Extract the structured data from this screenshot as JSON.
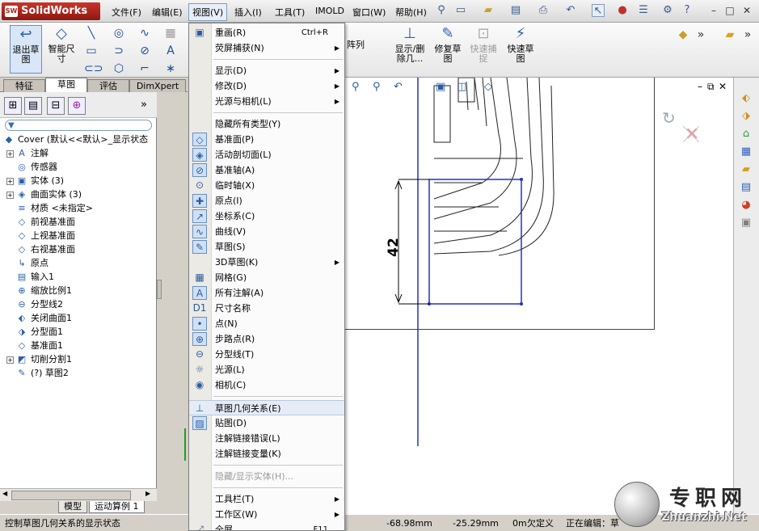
{
  "app": {
    "logo": "SolidWorks",
    "logo_badge": "SW"
  },
  "menubar": [
    {
      "id": "file",
      "label": "文件(F)"
    },
    {
      "id": "edit",
      "label": "编辑(E)"
    },
    {
      "id": "view",
      "label": "视图(V)"
    },
    {
      "id": "insert",
      "label": "插入(I)"
    },
    {
      "id": "tools",
      "label": "工具(T)"
    },
    {
      "id": "imold",
      "label": "IMOLD"
    },
    {
      "id": "window",
      "label": "窗口(W)"
    },
    {
      "id": "help",
      "label": "帮助(H)"
    }
  ],
  "cmdbar": {
    "exit_sketch": "退出草\n图",
    "smart_dim": "智能尺\n寸",
    "linear_array": "阵列",
    "show_delete": "显示/删\n除几...",
    "repair_sketch": "修复草\n图",
    "quick_snap": "快速捕\n捉",
    "rapid_sketch": "快速草\n图"
  },
  "tabs": {
    "feature": "特征",
    "sketch": "草图",
    "evaluate": "评估",
    "dimxpert": "DimXpert"
  },
  "tree": [
    {
      "icon": "part-icon",
      "glyph": "◆",
      "label": "Cover  (默认<<默认>_显示状态",
      "expand": false,
      "indent": 0
    },
    {
      "icon": "annotation-icon",
      "glyph": "A",
      "label": "注解",
      "expand": true,
      "indent": 1
    },
    {
      "icon": "sensor-icon",
      "glyph": "◎",
      "label": "传感器",
      "expand": false,
      "indent": 1
    },
    {
      "icon": "solid-body-icon",
      "glyph": "▣",
      "label": "实体 (3)",
      "expand": true,
      "indent": 1
    },
    {
      "icon": "surface-body-icon",
      "glyph": "◈",
      "label": "曲面实体 (3)",
      "expand": true,
      "indent": 1
    },
    {
      "icon": "material-icon",
      "glyph": "≡",
      "label": "材质 <未指定>",
      "expand": false,
      "indent": 1
    },
    {
      "icon": "plane-icon",
      "glyph": "◇",
      "label": "前视基准面",
      "expand": false,
      "indent": 1
    },
    {
      "icon": "plane-icon",
      "glyph": "◇",
      "label": "上视基准面",
      "expand": false,
      "indent": 1
    },
    {
      "icon": "plane-icon",
      "glyph": "◇",
      "label": "右视基准面",
      "expand": false,
      "indent": 1
    },
    {
      "icon": "origin-icon",
      "glyph": "↳",
      "label": "原点",
      "expand": false,
      "indent": 1
    },
    {
      "icon": "import-icon",
      "glyph": "▤",
      "label": "输入1",
      "expand": false,
      "indent": 1
    },
    {
      "icon": "scale-icon",
      "glyph": "⊕",
      "label": "缩放比例1",
      "expand": false,
      "indent": 1
    },
    {
      "icon": "parting-line-icon",
      "glyph": "⊖",
      "label": "分型线2",
      "expand": false,
      "indent": 1
    },
    {
      "icon": "shutoff-icon",
      "glyph": "⬖",
      "label": "关闭曲面1",
      "expand": false,
      "indent": 1
    },
    {
      "icon": "parting-surface-icon",
      "glyph": "⬗",
      "label": "分型面1",
      "expand": false,
      "indent": 1
    },
    {
      "icon": "plane-icon",
      "glyph": "◇",
      "label": "基准面1",
      "expand": false,
      "indent": 1
    },
    {
      "icon": "tooling-split-icon",
      "glyph": "◩",
      "label": "切削分割1",
      "expand": true,
      "indent": 1
    },
    {
      "icon": "sketch-icon",
      "glyph": "✎",
      "label": "(?) 草图2",
      "expand": false,
      "indent": 1
    }
  ],
  "bottom_tabs": {
    "model": "模型",
    "motion": "运动算例 1"
  },
  "status": {
    "hint": "控制草图几何关系的显示状态",
    "x": "-68.98mm",
    "y": "-25.29mm",
    "z": "0m",
    "state": "欠定义",
    "editing": "正在编辑：草"
  },
  "menu": {
    "items": [
      {
        "type": "item",
        "label": "重画(R)",
        "key": "Ctrl+R",
        "icon": "redraw-icon",
        "glyph": "▣",
        "boxed": false
      },
      {
        "type": "item",
        "label": "荧屏捕获(N)",
        "arrow": true
      },
      {
        "type": "sep"
      },
      {
        "type": "item",
        "label": "显示(D)",
        "arrow": true
      },
      {
        "type": "item",
        "label": "修改(D)",
        "arrow": true
      },
      {
        "type": "item",
        "label": "光源与相机(L)",
        "arrow": true
      },
      {
        "type": "sep"
      },
      {
        "type": "item",
        "label": "隐藏所有类型(Y)"
      },
      {
        "type": "item",
        "label": "基准面(P)",
        "icon": "plane-icon",
        "glyph": "◇",
        "boxed": true
      },
      {
        "type": "item",
        "label": "活动剖切面(L)",
        "icon": "section-plane-icon",
        "glyph": "◈",
        "boxed": true
      },
      {
        "type": "item",
        "label": "基准轴(A)",
        "icon": "axis-icon",
        "glyph": "⊘",
        "boxed": true
      },
      {
        "type": "item",
        "label": "临时轴(X)",
        "icon": "temp-axis-icon",
        "glyph": "⊙",
        "boxed": false
      },
      {
        "type": "item",
        "label": "原点(I)",
        "icon": "origin-icon",
        "glyph": "✚",
        "boxed": true
      },
      {
        "type": "item",
        "label": "坐标系(C)",
        "icon": "coordinate-icon",
        "glyph": "↗",
        "boxed": true
      },
      {
        "type": "item",
        "label": "曲线(V)",
        "icon": "curve-icon",
        "glyph": "∿",
        "boxed": true
      },
      {
        "type": "item",
        "label": "草图(S)",
        "icon": "sketch-icon",
        "glyph": "✎",
        "boxed": true
      },
      {
        "type": "item",
        "label": "3D草图(K)",
        "arrow": true
      },
      {
        "type": "item",
        "label": "网格(G)",
        "icon": "grid-icon",
        "glyph": "▦",
        "boxed": false
      },
      {
        "type": "item",
        "label": "所有注解(A)",
        "icon": "annotation-icon",
        "glyph": "A",
        "boxed": true
      },
      {
        "type": "item",
        "label": "尺寸名称",
        "icon": "dim-name-icon",
        "glyph": "D1",
        "boxed": false
      },
      {
        "type": "item",
        "label": "点(N)",
        "icon": "point-icon",
        "glyph": "•",
        "boxed": true
      },
      {
        "type": "item",
        "label": "步路点(R)",
        "icon": "route-point-icon",
        "glyph": "⊕",
        "boxed": true
      },
      {
        "type": "item",
        "label": "分型线(T)",
        "icon": "parting-line-icon",
        "glyph": "⊖",
        "boxed": false
      },
      {
        "type": "item",
        "label": "光源(L)",
        "icon": "light-icon",
        "glyph": "☼",
        "boxed": false
      },
      {
        "type": "item",
        "label": "相机(C)",
        "icon": "camera-icon",
        "glyph": "◉",
        "boxed": false
      },
      {
        "type": "sep"
      },
      {
        "type": "item",
        "label": "草图几何关系(E)",
        "icon": "sketch-relations-icon",
        "glyph": "⊥",
        "boxed": false,
        "hover": true
      },
      {
        "type": "item",
        "label": "贴图(D)",
        "icon": "decal-icon",
        "glyph": "▨",
        "boxed": true
      },
      {
        "type": "item",
        "label": "注解链接错误(L)"
      },
      {
        "type": "item",
        "label": "注解链接变量(K)"
      },
      {
        "type": "sep"
      },
      {
        "type": "item",
        "label": "隐藏/显示实体(H)...",
        "disabled": true
      },
      {
        "type": "sep"
      },
      {
        "type": "item",
        "label": "工具栏(T)",
        "arrow": true
      },
      {
        "type": "item",
        "label": "工作区(W)",
        "arrow": true
      },
      {
        "type": "item",
        "label": "全屏",
        "key": "F11",
        "icon": "fullscreen-icon",
        "glyph": "⤢",
        "boxed": false
      }
    ]
  },
  "sketch": {
    "dimension": "42"
  },
  "watermark": {
    "cn": "专职网",
    "en": "Zhuanzhi.Net"
  }
}
